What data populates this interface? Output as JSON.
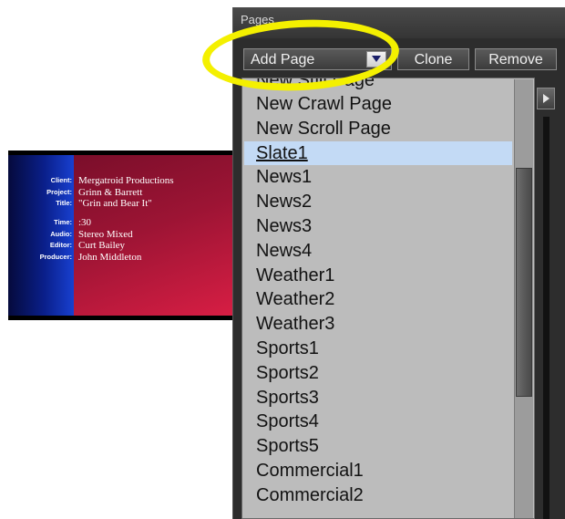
{
  "slate": {
    "fields": [
      {
        "label": "Client:",
        "value": "Mergatroid Productions"
      },
      {
        "label": "Project:",
        "value": "Grinn & Barrett"
      },
      {
        "label": "Title:",
        "value": "\"Grin and Bear It\""
      },
      {
        "label": "Time:",
        "value": ":30"
      },
      {
        "label": "Audio:",
        "value": "Stereo Mixed"
      },
      {
        "label": "Editor:",
        "value": "Curt Bailey"
      },
      {
        "label": "Producer:",
        "value": "John Middleton"
      }
    ]
  },
  "panel": {
    "title": "Pages",
    "add_page_label": "Add Page",
    "clone_label": "Clone",
    "remove_label": "Remove"
  },
  "dropdown": {
    "selected": "Slate1",
    "items": [
      "New Still Page",
      "New Crawl Page",
      "New Scroll Page",
      "Slate1",
      "News1",
      "News2",
      "News3",
      "News4",
      "Weather1",
      "Weather2",
      "Weather3",
      "Sports1",
      "Sports2",
      "Sports3",
      "Sports4",
      "Sports5",
      "Commercial1",
      "Commercial2"
    ],
    "scroll_position": 0.42,
    "scroll_visible_fraction": 0.52
  },
  "colors": {
    "highlight": "#f4f000",
    "selection": "#c3daf5",
    "panel_bg": "#2d2d2d",
    "list_bg": "#bcbcbc"
  },
  "icons": {
    "dropdown_arrow": "caret-down-icon",
    "nav_arrow": "caret-right-icon"
  }
}
